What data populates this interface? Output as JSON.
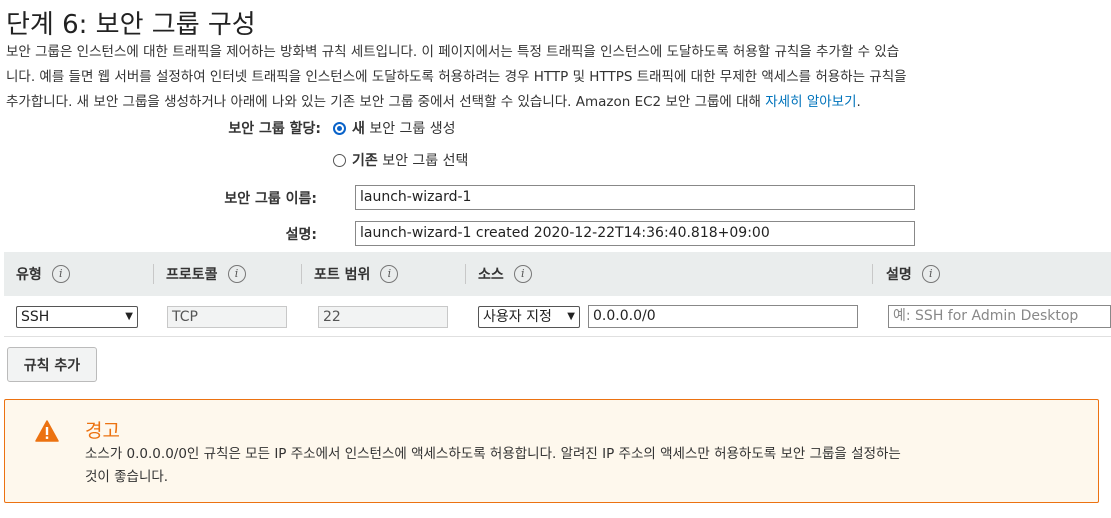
{
  "title": "단계 6: 보안 그룹 구성",
  "intro": {
    "line1": "보안 그룹은 인스턴스에 대한 트래픽을 제어하는 방화벽 규칙 세트입니다. 이 페이지에서는 특정 트래픽을 인스턴스에 도달하도록 허용할 규칙을 추가할 수 있습",
    "line2": "니다. 예를 들면 웹 서버를 설정하여 인터넷 트래픽을 인스턴스에 도달하도록 허용하려는 경우 HTTP 및 HTTPS 트래픽에 대한 무제한 액세스를 허용하는 규칙을",
    "line3": "추가합니다. 새 보안 그룹을 생성하거나 아래에 나와 있는 기존 보안 그룹 중에서 선택할 수 있습니다. Amazon EC2 보안 그룹에 대해 ",
    "link": "자세히 알아보기",
    "period": "."
  },
  "assignment": {
    "label": "보안 그룹 할당:",
    "option_new_bold": "새",
    "option_new_rest": " 보안 그룹 생성",
    "option_existing_bold": "기존",
    "option_existing_rest": " 보안 그룹 선택",
    "selected": "new"
  },
  "group_name": {
    "label": "보안 그룹 이름:",
    "value": "launch-wizard-1"
  },
  "description": {
    "label": "설명:",
    "value": "launch-wizard-1 created 2020-12-22T14:36:40.818+09:00"
  },
  "table": {
    "headers": {
      "type": "유형",
      "protocol": "프로토콜",
      "port_range": "포트 범위",
      "source": "소스",
      "description": "설명"
    },
    "rows": [
      {
        "type": "SSH",
        "protocol": "TCP",
        "port_range": "22",
        "source_select": "사용자 지정",
        "source_value": "0.0.0.0/0",
        "description_placeholder": "예: SSH for Admin Desktop"
      }
    ]
  },
  "add_rule_button": "규칙 추가",
  "warning": {
    "title": "경고",
    "line1": "소스가 0.0.0.0/0인 규칙은 모든 IP 주소에서 인스턴스에 액세스하도록 허용합니다. 알려진 IP 주소의 액세스만 허용하도록 보안 그룹을 설정하는",
    "line2": "것이 좋습니다.",
    "accent_color": "#ec7211"
  },
  "colors": {
    "link": "#0073bb",
    "radio": "#0a63c9",
    "table_header_bg": "#eaeded"
  },
  "icons": {
    "info": "info-icon",
    "warning": "warning-icon",
    "dropdown": "chevron-down-icon"
  }
}
